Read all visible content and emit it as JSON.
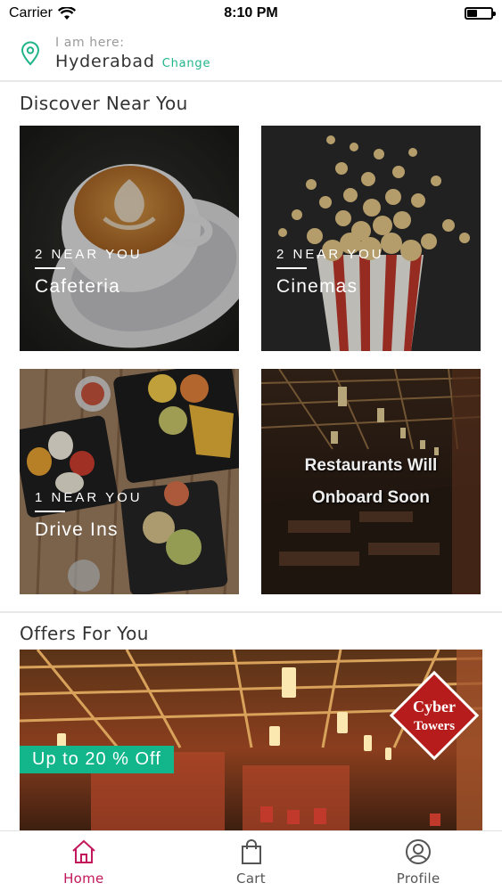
{
  "status_bar": {
    "carrier": "Carrier",
    "time": "8:10 PM",
    "battery_level": 0.4
  },
  "location": {
    "caption": "I am here:",
    "city": "Hyderabad",
    "change_label": "Change",
    "icon": "location-pin-icon",
    "accent_color": "#22b58a"
  },
  "discover": {
    "title": "Discover Near You",
    "tiles": [
      {
        "count": "2 NEAR YOU",
        "name": "Cafeteria"
      },
      {
        "count": "2 NEAR YOU",
        "name": "Cinemas"
      },
      {
        "count": "1 NEAR YOU",
        "name": "Drive Ins"
      },
      {
        "soon_line1": "Restaurants Will",
        "soon_line2": "Onboard Soon"
      }
    ]
  },
  "offers": {
    "title": "Offers For You",
    "badge": "Up to 20 % Off",
    "logo_line1": "Cyber",
    "logo_line2": "Towers",
    "badge_color": "#13b58b"
  },
  "tabbar": {
    "items": [
      {
        "label": "Home",
        "icon": "home-icon",
        "active": true
      },
      {
        "label": "Cart",
        "icon": "shopping-bag-icon",
        "active": false
      },
      {
        "label": "Profile",
        "icon": "user-circle-icon",
        "active": false
      }
    ],
    "active_color": "#c2185b"
  }
}
